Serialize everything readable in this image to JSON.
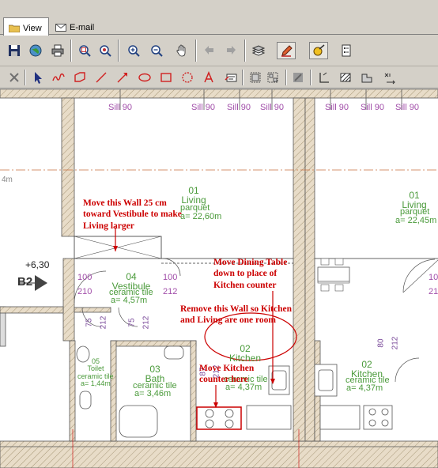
{
  "tabs": [
    {
      "label": "View",
      "icon": "folder-icon",
      "active": true
    },
    {
      "label": "E-mail",
      "icon": "envelope-icon",
      "active": false
    }
  ],
  "plan": {
    "sill_label": "Sill 90",
    "level_label": "+6,30",
    "section_marker": "B2",
    "grid_label": "4m",
    "rooms": {
      "living_left": {
        "num": "01",
        "name": "Living",
        "finish": "parquet",
        "area": "a= 22,60m"
      },
      "living_right": {
        "num": "01",
        "name": "Living",
        "finish": "parquet",
        "area": "a= 22,45m"
      },
      "vestibule": {
        "num": "04",
        "name": "Vestibule",
        "finish": "ceramic tile",
        "area": "a= 4,57m"
      },
      "bath": {
        "num": "03",
        "name": "Bath",
        "finish": "ceramic tile",
        "area": "a= 3,46m"
      },
      "toilet": {
        "num": "05",
        "name": "Toilet",
        "finish": "ceramic tile",
        "area": "a= 1,44m"
      },
      "kitchen_left": {
        "num": "02",
        "name": "Kitchen",
        "finish": "ceramic tile",
        "area": "a= 4,37m"
      },
      "kitchen_right": {
        "num": "02",
        "name": "Kitchen",
        "finish": "ceramic tile",
        "area": "a= 4,37m"
      }
    },
    "door_dims": {
      "w100": "100",
      "h210": "210",
      "w75": "75",
      "h212": "212",
      "w87": "87",
      "w80": "80"
    },
    "notes": {
      "move_wall": "Move this Wall 25 cm toward Vestibule to make Living larger",
      "move_table": "Move Dining Table down to place of Kitchen counter",
      "remove_wall": "Remove this Wall so Kitchen and Living are one room",
      "move_counter": "Move Kitchen counter here"
    }
  },
  "colors": {
    "note": "#cc0000",
    "room_text": "#4a9a3a",
    "sill_text": "#a14ea9",
    "wall_hatch": "#b8a890"
  }
}
